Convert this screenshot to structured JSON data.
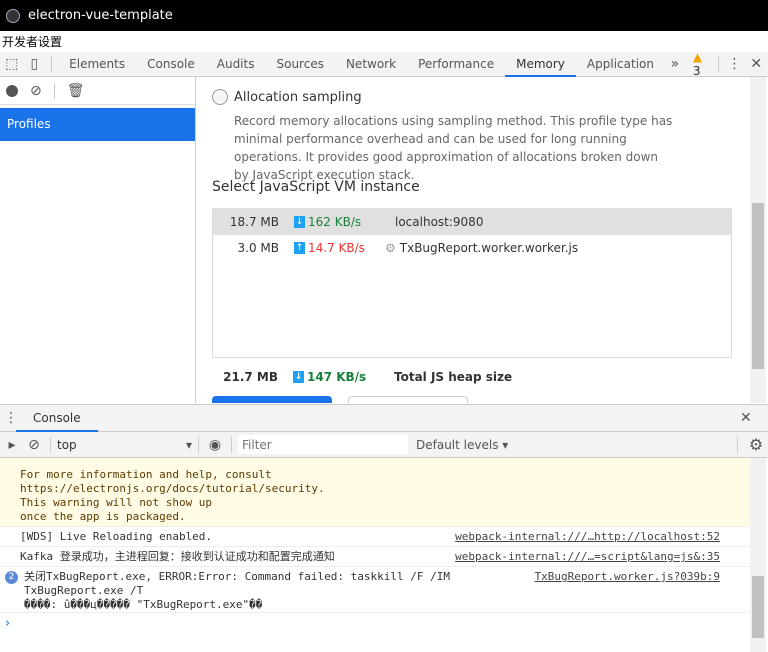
{
  "window": {
    "title": "electron-vue-template"
  },
  "menu": {
    "item": "开发者设置"
  },
  "devtools": {
    "tabs": [
      "Elements",
      "Console",
      "Audits",
      "Sources",
      "Network",
      "Performance",
      "Memory",
      "Application"
    ],
    "active_tab": "Memory",
    "more": "»",
    "warnings": "3"
  },
  "sidebar": {
    "profiles": "Profiles"
  },
  "memory": {
    "option_label": "Allocation sampling",
    "option_desc": "Record memory allocations using sampling method. This profile type has minimal performance overhead and can be used for long running operations. It provides good approximation of allocations broken down by JavaScript execution stack.",
    "vm_title": "Select JavaScript VM instance",
    "instances": [
      {
        "size": "18.7 MB",
        "rate": "162 KB/s",
        "dir": "down",
        "name": "localhost:9080"
      },
      {
        "size": "3.0 MB",
        "rate": "14.7 KB/s",
        "dir": "up",
        "name": "TxBugReport.worker.worker.js"
      }
    ],
    "total": {
      "size": "21.7 MB",
      "rate": "147 KB/s",
      "label": "Total JS heap size"
    }
  },
  "console": {
    "tab": "Console",
    "context": "top",
    "filter_placeholder": "Filter",
    "levels": "Default levels ▾",
    "warning_lines": [
      "For more information and help, consult",
      "https://electronjs.org/docs/tutorial/security",
      ".",
      "This warning will not show up",
      "once the app is packaged."
    ],
    "messages": [
      {
        "text": "[WDS] Live Reloading enabled.",
        "source": "webpack-internal:///…http://localhost:52"
      },
      {
        "text": "Kafka 登录成功，主进程回复：接收到认证成功和配置完成通知",
        "source": "webpack-internal:///…=script&lang=js&:35"
      },
      {
        "count": "2",
        "lines": [
          "关闭TxBugReport.exe, ERROR:Error: Command failed: taskkill /F /IM",
          "TxBugReport.exe /T",
          "����: û���ц����� \"TxBugReport.exe\"��"
        ],
        "source": "TxBugReport.worker.js?039b:9"
      }
    ],
    "prompt": "›"
  }
}
